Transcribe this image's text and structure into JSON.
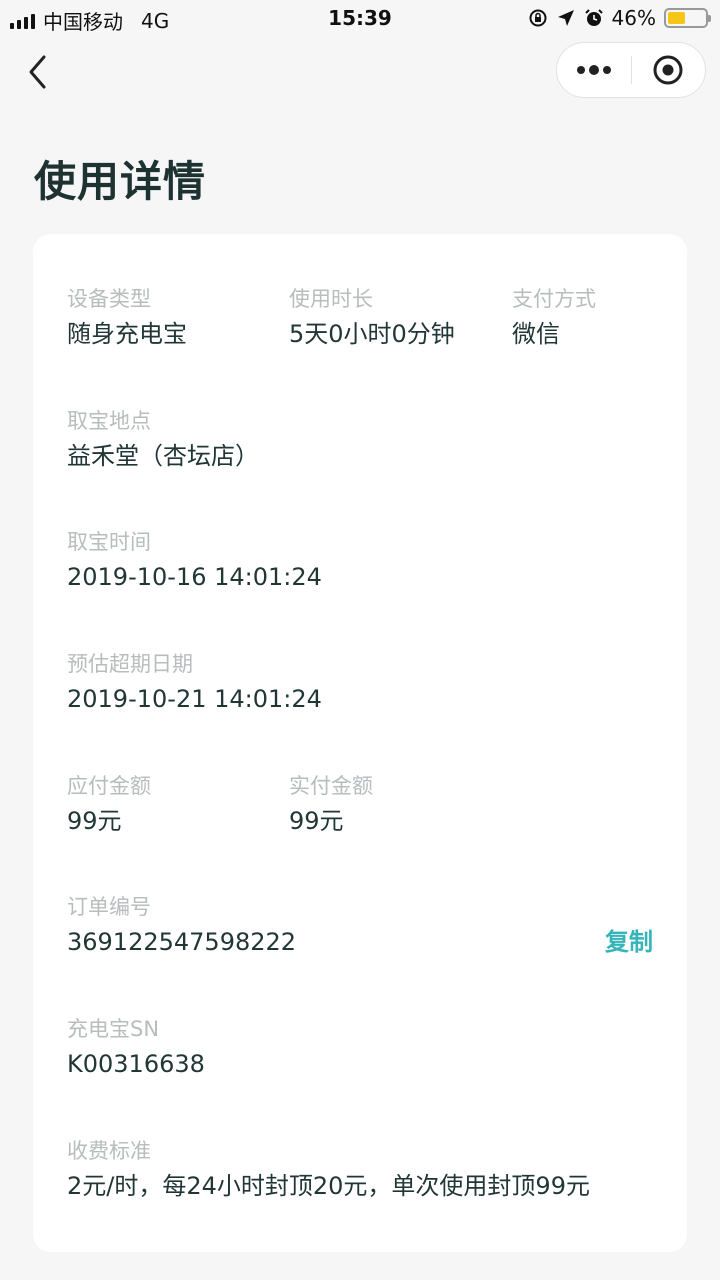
{
  "status_bar": {
    "carrier": "中国移动",
    "network": "4G",
    "time": "15:39",
    "battery": "46%",
    "battery_level": 0.46,
    "battery_color": "#f5c518"
  },
  "nav": {
    "back_icon": "chevron-left-icon",
    "more_icon": "more-dots-icon",
    "close_icon": "target-circle-icon"
  },
  "page": {
    "title": "使用详情"
  },
  "details": {
    "device_type": {
      "label": "设备类型",
      "value": "随身充电宝"
    },
    "duration": {
      "label": "使用时长",
      "value": "5天0小时0分钟"
    },
    "payment_method": {
      "label": "支付方式",
      "value": "微信"
    },
    "pickup_location": {
      "label": "取宝地点",
      "value": "益禾堂（杏坛店）"
    },
    "pickup_time": {
      "label": "取宝时间",
      "value": "2019-10-16 14:01:24"
    },
    "overdue_date": {
      "label": "预估超期日期",
      "value": "2019-10-21 14:01:24"
    },
    "amount_due": {
      "label": "应付金额",
      "value": "99元"
    },
    "amount_paid": {
      "label": "实付金额",
      "value": "99元"
    },
    "order_number": {
      "label": "订单编号",
      "value": "369122547598222",
      "copy_label": "复制"
    },
    "powerbank_sn": {
      "label": "充电宝SN",
      "value": "K00316638"
    },
    "pricing": {
      "label": "收费标准",
      "value": "2元/时，每24小时封顶20元，单次使用封顶99元"
    }
  },
  "colors": {
    "accent": "#35b5b8",
    "label": "#b7bcbc",
    "value": "#223636"
  }
}
